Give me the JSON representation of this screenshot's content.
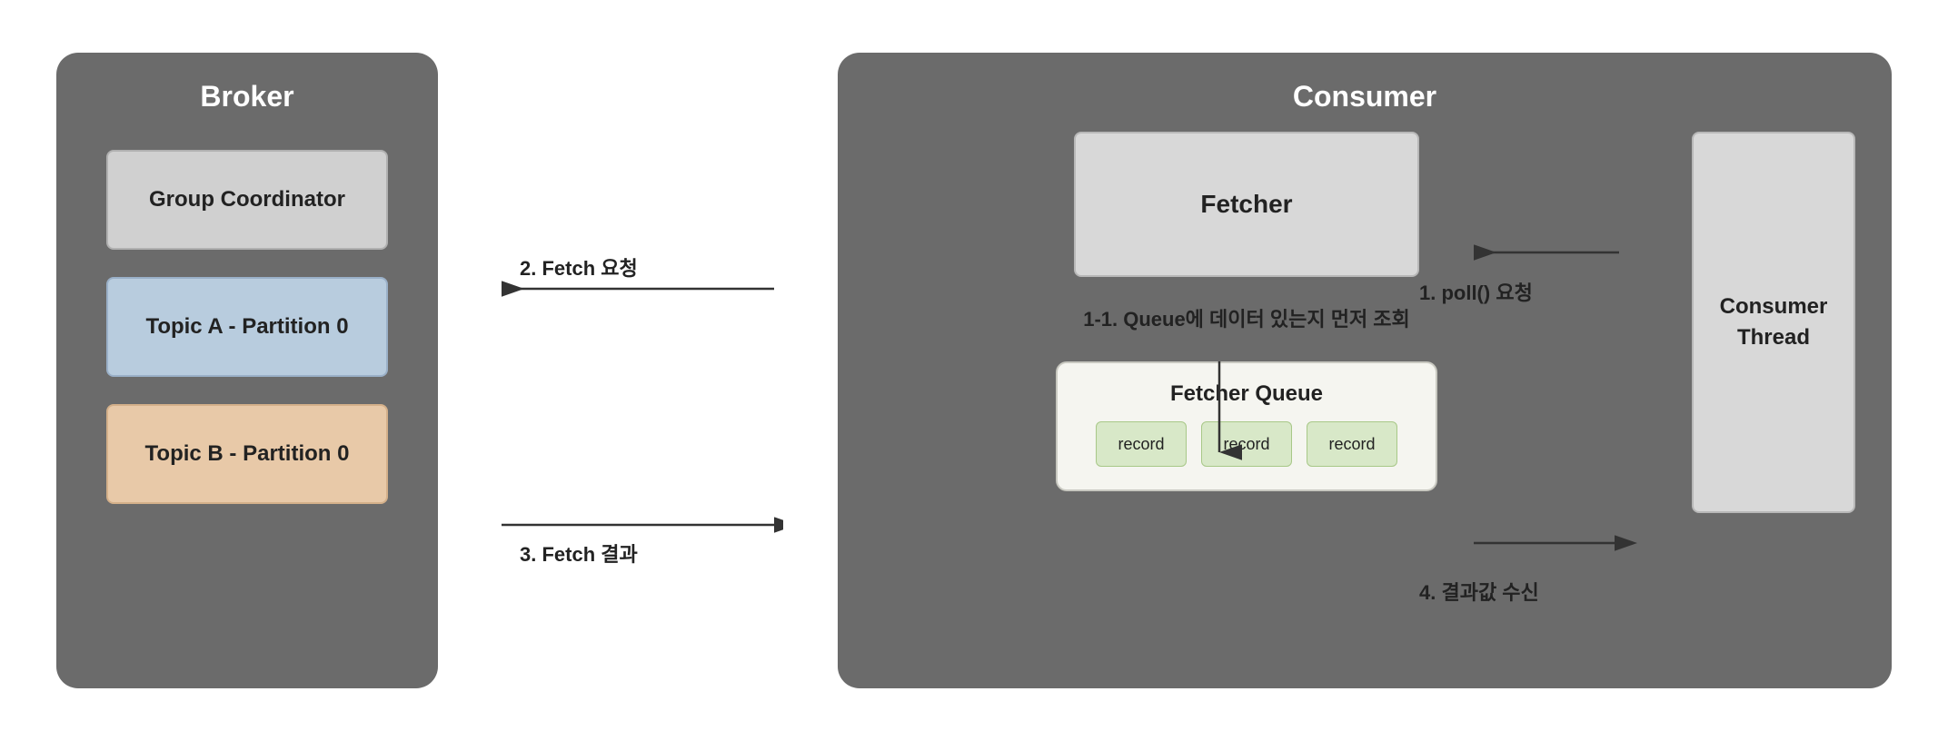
{
  "broker": {
    "title": "Broker",
    "group_coordinator": "Group Coordinator",
    "partition_a": "Topic A - Partition 0",
    "partition_b": "Topic B - Partition 0"
  },
  "consumer": {
    "title": "Consumer",
    "fetcher": "Fetcher",
    "fetcher_queue": "Fetcher Queue",
    "consumer_thread": "Consumer\nThread",
    "records": [
      "record",
      "record",
      "record"
    ]
  },
  "arrows": {
    "fetch_request": "2. Fetch 요청",
    "fetch_result": "3. Fetch 결과",
    "poll_request": "1. poll() 요청",
    "queue_check": "1-1.  Queue에 데이터  있는지\n먼저 조회",
    "result_receive": "4. 결과값 수신"
  }
}
